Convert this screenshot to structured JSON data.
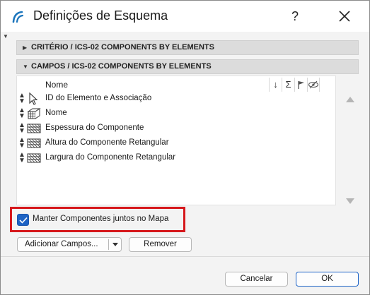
{
  "dialog": {
    "title": "Definições de Esquema",
    "help_label": "?"
  },
  "sections": {
    "criteria": {
      "label": "CRITÉRIO / ICS-02 COMPONENTS BY ELEMENTS",
      "expanded": false
    },
    "fields": {
      "label": "CAMPOS / ICS-02 COMPONENTS BY ELEMENTS",
      "expanded": true
    }
  },
  "fields_list": {
    "header": {
      "name": "Nome",
      "sort_icon": "↓",
      "sum_icon": "Σ",
      "flag_icon": "flag",
      "visibility_icon": "eye-hidden"
    },
    "rows": [
      {
        "label": "ID do Elemento e Associação",
        "icon": "arrow-pointer-icon"
      },
      {
        "label": "Nome",
        "icon": "cube-grid-icon"
      },
      {
        "label": "Espessura do Componente",
        "icon": "hatch-layers-icon"
      },
      {
        "label": "Altura do Componente Retangular",
        "icon": "hatch-layers-icon"
      },
      {
        "label": "Largura do Componente Retangular",
        "icon": "hatch-layers-icon"
      }
    ]
  },
  "options": {
    "keep_components_label": "Manter Componentes juntos no Mapa",
    "keep_components_checked": true
  },
  "buttons": {
    "add_fields": "Adicionar Campos...",
    "remove": "Remover",
    "cancel": "Cancelar",
    "ok": "OK"
  },
  "colors": {
    "accent": "#1e63c4",
    "highlight": "#d6181c"
  }
}
